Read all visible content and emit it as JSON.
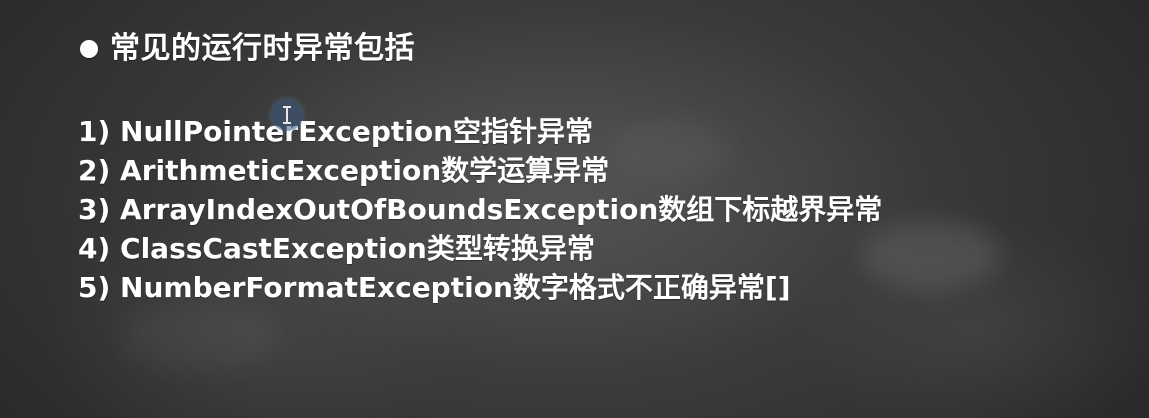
{
  "slide": {
    "title": "常见的运行时异常包括",
    "bullet_icon": "filled-circle",
    "items": [
      {
        "num": "1)",
        "exception": "NullPointerException",
        "desc": "空指针异常"
      },
      {
        "num": "2)",
        "exception": "ArithmeticException",
        "desc": "数学运算异常"
      },
      {
        "num": "3)",
        "exception": "ArrayIndexOutOfBoundsException",
        "desc": "数组下标越界异常"
      },
      {
        "num": "4)",
        "exception": "ClassCastException",
        "desc": "类型转换异常"
      },
      {
        "num": "5)",
        "exception": "NumberFormatException",
        "desc": "数字格式不正确异常[]"
      }
    ]
  },
  "cursor": {
    "icon": "text-cursor-icon"
  },
  "colors": {
    "text": "#ffffff",
    "background": "#333333",
    "cursor_highlight": "#3c5a82"
  }
}
